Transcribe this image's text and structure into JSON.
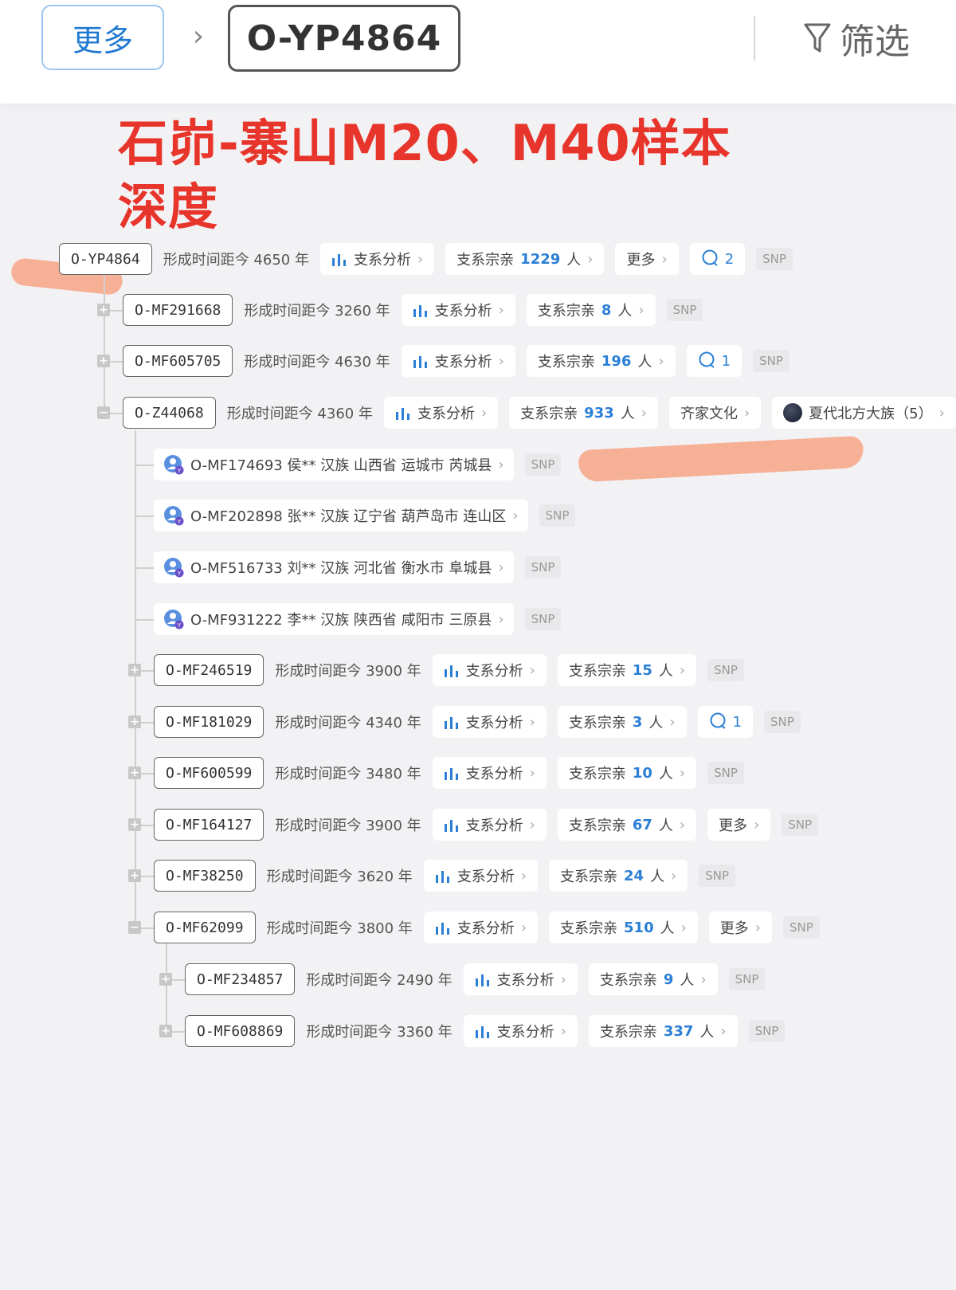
{
  "header": {
    "more_label": "更多",
    "breadcrumb_sep": "›",
    "current_node": "O-YP4864",
    "filter_label": "筛选"
  },
  "annotation": {
    "title": "石峁-寨山M20、M40样本深度"
  },
  "labels": {
    "branch_analysis": "支系分析",
    "clan_prefix": "支系宗亲",
    "clan_suffix": "人",
    "more": "更多",
    "snp": "SNP",
    "chev": "›"
  },
  "nodes": [
    {
      "id": "O-YP4864",
      "age": "形成时间距今 4650 年",
      "clan": "1229",
      "more": true,
      "comments": "2"
    },
    {
      "id": "O-MF291668",
      "age": "形成时间距今 3260 年",
      "clan": "8"
    },
    {
      "id": "O-MF605705",
      "age": "形成时间距今 4630 年",
      "clan": "196",
      "comments": "1"
    },
    {
      "id": "O-Z44068",
      "age": "形成时间距今 4360 年",
      "clan": "933",
      "culture": "齐家文化",
      "tribe": "夏代北方大族（5）"
    },
    {
      "id": "O-MF246519",
      "age": "形成时间距今 3900 年",
      "clan": "15"
    },
    {
      "id": "O-MF181029",
      "age": "形成时间距今 4340 年",
      "clan": "3",
      "comments": "1"
    },
    {
      "id": "O-MF600599",
      "age": "形成时间距今 3480 年",
      "clan": "10"
    },
    {
      "id": "O-MF164127",
      "age": "形成时间距今 3900 年",
      "clan": "67",
      "more": true
    },
    {
      "id": "O-MF38250",
      "age": "形成时间距今 3620 年",
      "clan": "24"
    },
    {
      "id": "O-MF62099",
      "age": "形成时间距今 3800 年",
      "clan": "510",
      "more": true
    },
    {
      "id": "O-MF234857",
      "age": "形成时间距今 2490 年",
      "clan": "9"
    },
    {
      "id": "O-MF608869",
      "age": "形成时间距今 3360 年",
      "clan": "337"
    }
  ],
  "persons": [
    {
      "text": "O-MF174693 侯** 汉族 山西省 运城市 芮城县"
    },
    {
      "text": "O-MF202898 张** 汉族 辽宁省 葫芦岛市 连山区"
    },
    {
      "text": "O-MF516733 刘** 汉族 河北省 衡水市 阜城县"
    },
    {
      "text": "O-MF931222 李** 汉族 陕西省 咸阳市 三原县"
    }
  ],
  "colors": {
    "accent": "#2b7fd6",
    "annotation_red": "#e8352b",
    "highlight_stroke": "#f6a98c"
  }
}
